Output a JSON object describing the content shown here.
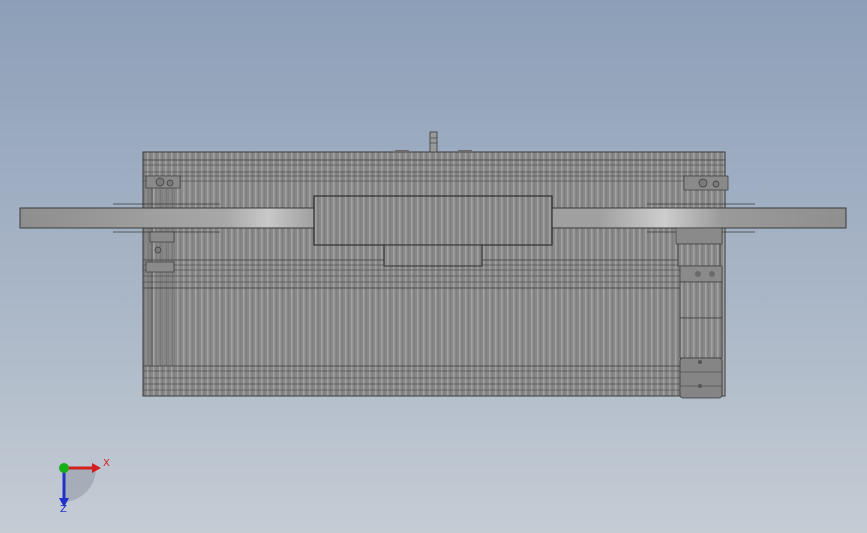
{
  "view": {
    "background_top": "#8d9fb8",
    "background_bottom": "#c5ccd4",
    "model_fill": "#8a8a8a",
    "model_edge": "#3a3a3a"
  },
  "triad": {
    "x_label": "X",
    "z_label": "Z",
    "x_color": "#d22020",
    "y_color": "#18b018",
    "z_color": "#2030c8"
  }
}
